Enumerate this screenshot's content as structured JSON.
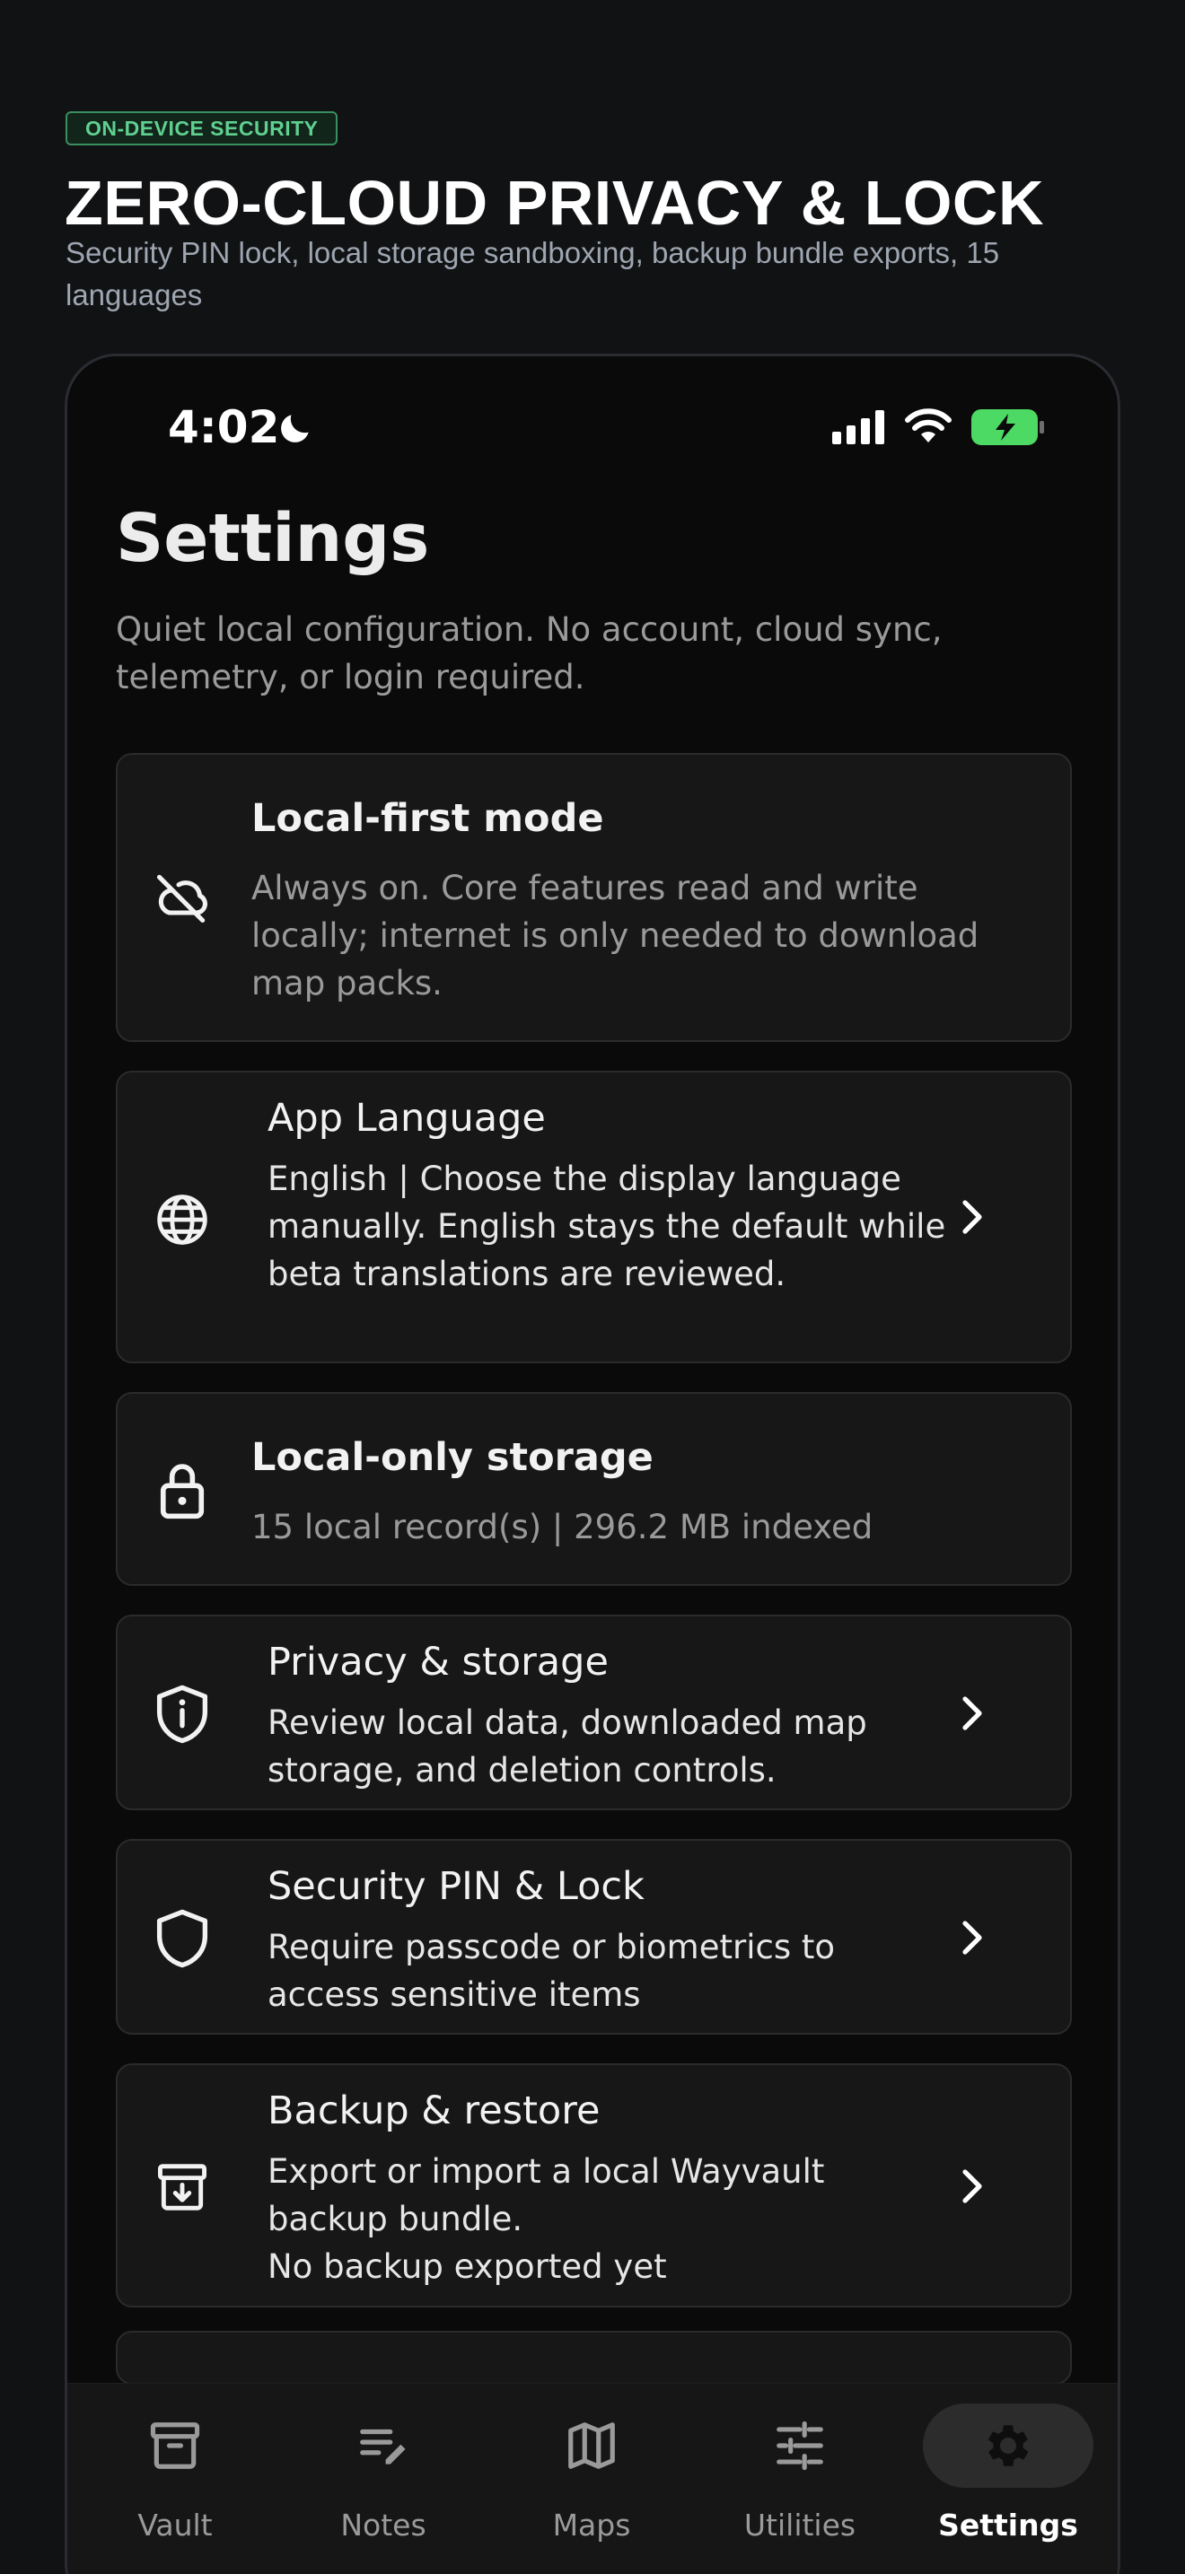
{
  "header": {
    "badge": "ON-DEVICE SECURITY",
    "title": "ZERO-CLOUD PRIVACY & LOCK",
    "subtitle": "Security PIN lock, local storage sandboxing, backup bundle exports, 15 languages"
  },
  "status_bar": {
    "time": "4:02",
    "icons": [
      "moon-icon",
      "signal-icon",
      "wifi-icon",
      "battery-charging-icon"
    ]
  },
  "page": {
    "title": "Settings",
    "description": "Quiet local configuration. No account, cloud sync, telemetry, or login required."
  },
  "cards": [
    {
      "icon": "cloud-off-icon",
      "title": "Local-first mode",
      "body": "Always on. Core features read and write locally; internet is only needed to download map packs.",
      "has_chevron": false
    },
    {
      "icon": "globe-icon",
      "title": "App Language",
      "body": "English | Choose the display language manually. English stays the default while beta translations are reviewed.",
      "has_chevron": true
    },
    {
      "icon": "lock-icon",
      "title": "Local-only storage",
      "body": "15 local record(s) | 296.2 MB indexed",
      "has_chevron": false
    },
    {
      "icon": "shield-info-icon",
      "title": "Privacy & storage",
      "body": "Review local data, downloaded map storage, and deletion controls.",
      "has_chevron": true
    },
    {
      "icon": "shield-icon",
      "title": "Security PIN & Lock",
      "body": "Require passcode or biometrics to access sensitive items",
      "has_chevron": true
    },
    {
      "icon": "archive-download-icon",
      "title": "Backup & restore",
      "body": "Export or import a local Wayvault backup bundle.",
      "body2": "No backup exported yet",
      "has_chevron": true
    }
  ],
  "tabbar": {
    "items": [
      {
        "label": "Vault",
        "icon": "archive-box-icon",
        "active": false
      },
      {
        "label": "Notes",
        "icon": "notes-edit-icon",
        "active": false
      },
      {
        "label": "Maps",
        "icon": "map-icon",
        "active": false
      },
      {
        "label": "Utilities",
        "icon": "sliders-icon",
        "active": false
      },
      {
        "label": "Settings",
        "icon": "gear-icon",
        "active": true
      }
    ]
  },
  "colors": {
    "accent_green": "#5fd08f",
    "battery_green": "#4cd964",
    "background": "#0a0a0a",
    "card": "#171717"
  }
}
